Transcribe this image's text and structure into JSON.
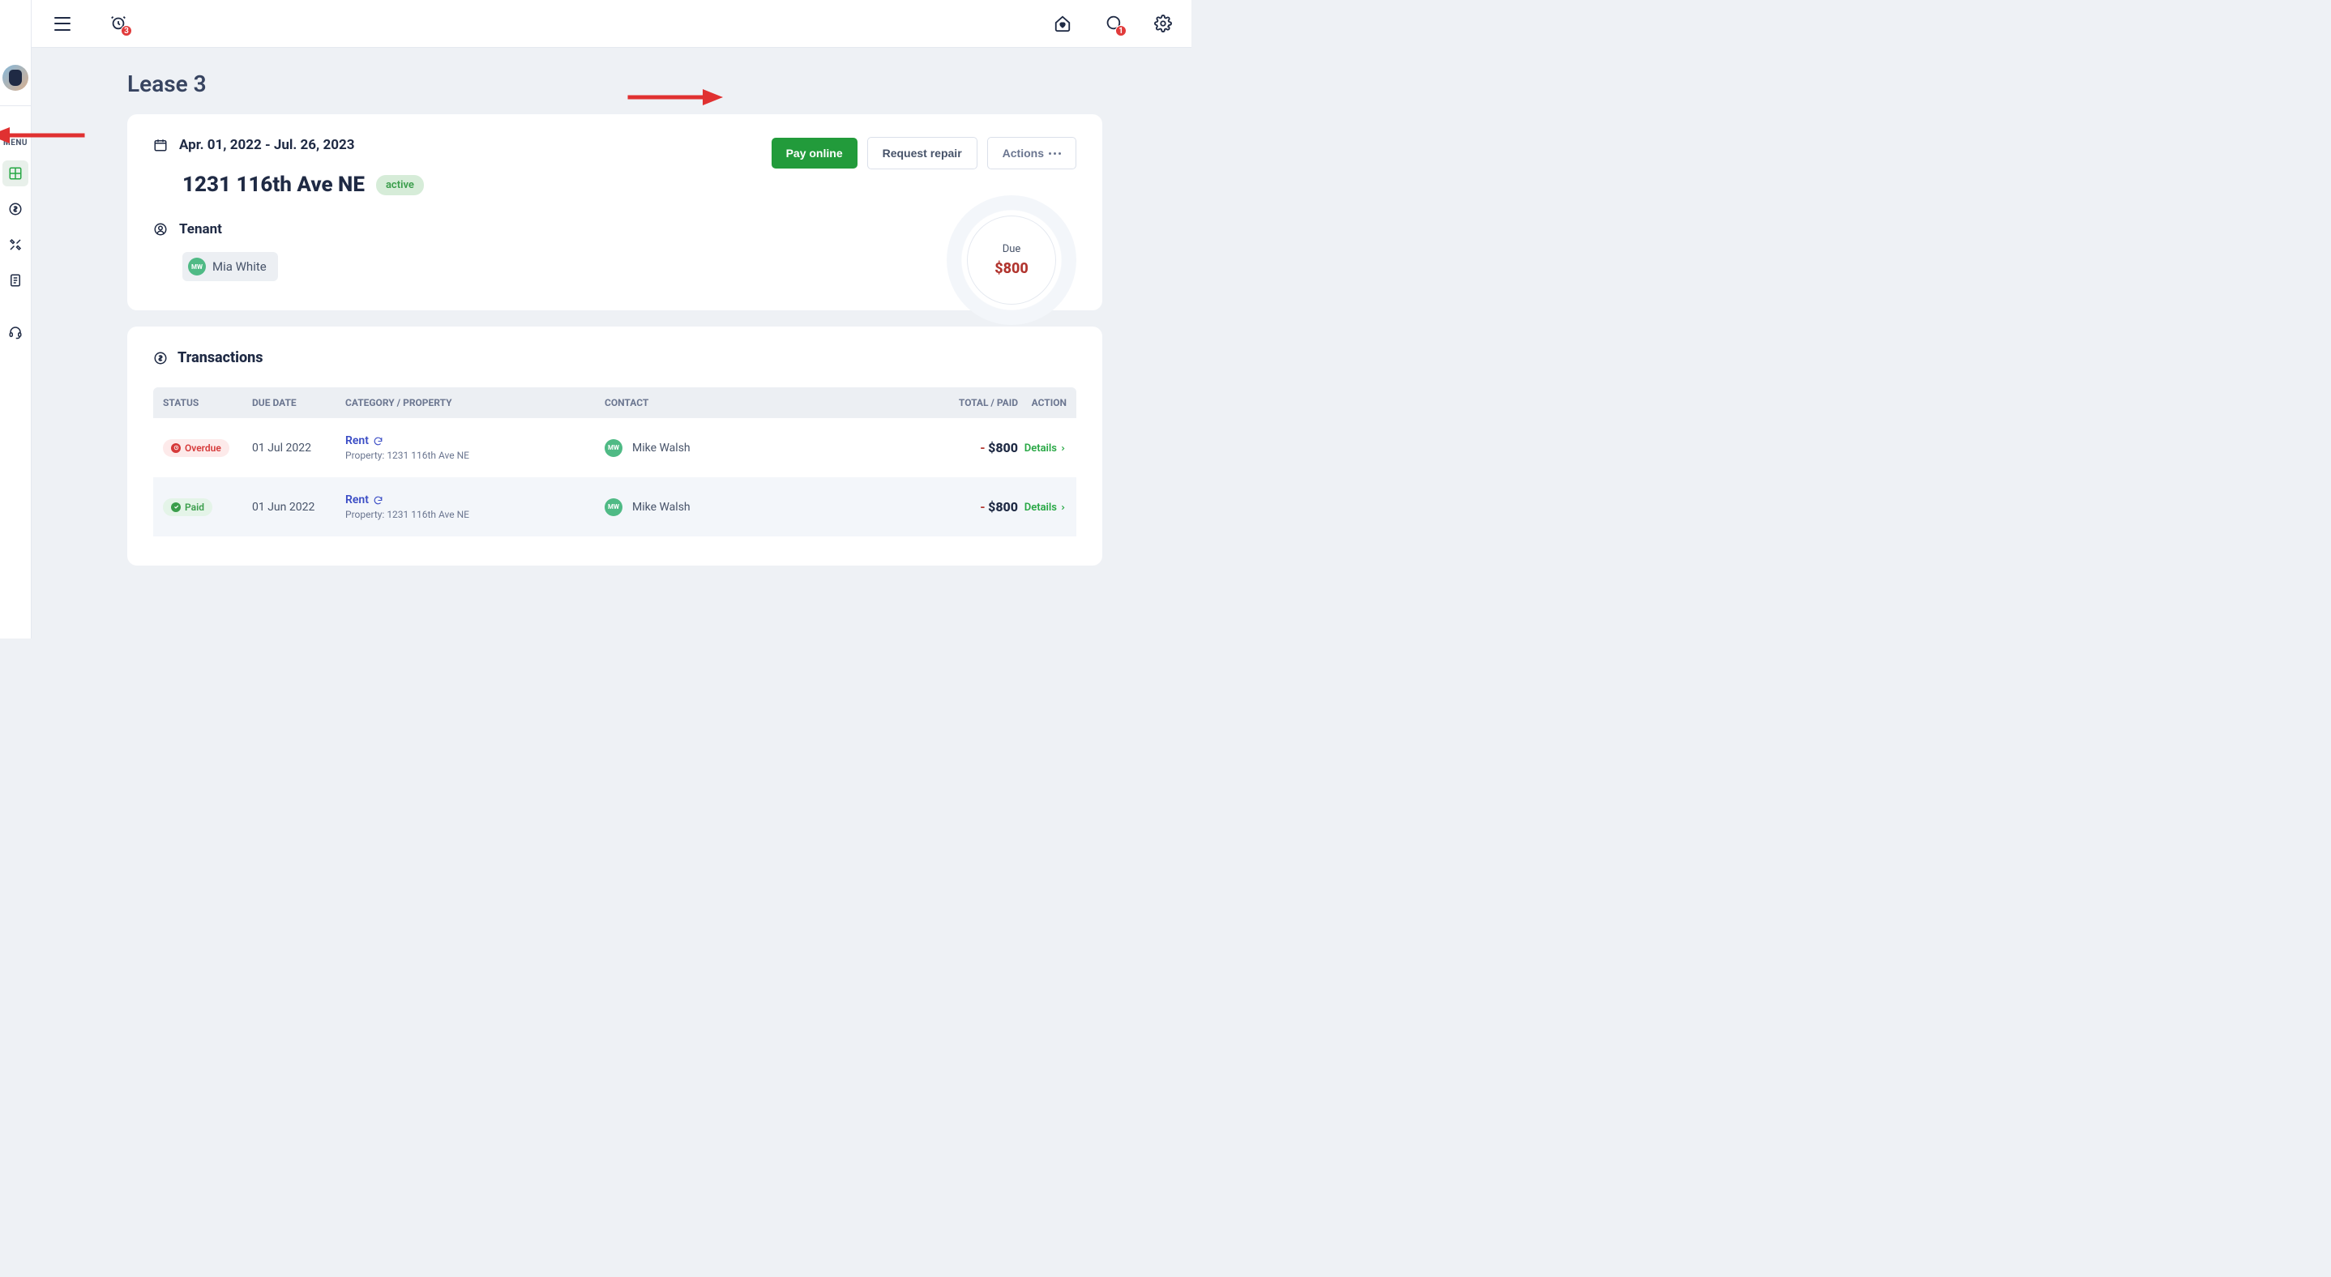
{
  "topbar": {
    "alerts_count": "3",
    "chat_count": "1"
  },
  "sidebar": {
    "menu_label": "MENU"
  },
  "page": {
    "title": "Lease 3"
  },
  "lease": {
    "date_range": "Apr. 01, 2022 - Jul. 26, 2023",
    "address": "1231 116th Ave NE",
    "status": "active",
    "tenant_section_label": "Tenant",
    "tenant": {
      "initials": "MW",
      "name": "Mia White"
    },
    "buttons": {
      "pay_online": "Pay online",
      "request_repair": "Request repair",
      "actions": "Actions"
    },
    "due": {
      "label": "Due",
      "amount": "$800"
    }
  },
  "transactions": {
    "title": "Transactions",
    "columns": {
      "status": "STATUS",
      "due_date": "DUE DATE",
      "category": "CATEGORY / PROPERTY",
      "contact": "CONTACT",
      "total": "TOTAL / PAID",
      "action": "ACTION"
    },
    "rows": [
      {
        "status_kind": "overdue",
        "status_label": "Overdue",
        "due_date": "01 Jul 2022",
        "category": "Rent",
        "property_prefix": "Property: ",
        "property": "1231 116th Ave NE",
        "contact_initials": "MW",
        "contact_name": "Mike Walsh",
        "total_sign": "-",
        "total_amount": "$800",
        "action_label": "Details"
      },
      {
        "status_kind": "paid",
        "status_label": "Paid",
        "due_date": "01 Jun 2022",
        "category": "Rent",
        "property_prefix": "Property: ",
        "property": "1231 116th Ave NE",
        "contact_initials": "MW",
        "contact_name": "Mike Walsh",
        "total_sign": "-",
        "total_amount": "$800",
        "action_label": "Details"
      }
    ]
  }
}
